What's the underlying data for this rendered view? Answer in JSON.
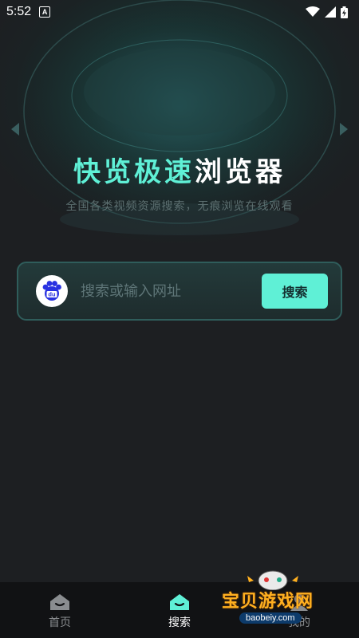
{
  "status_bar": {
    "time": "5:52",
    "notification_icon": "A"
  },
  "hero": {
    "title_part1": "快览极速",
    "title_part2": "浏览器",
    "subtitle": "全国各类视频资源搜索，无痕浏览在线观看"
  },
  "search": {
    "placeholder": "搜索或输入网址",
    "engine_icon": "baidu-logo-icon",
    "button_label": "搜索"
  },
  "nav": {
    "items": [
      {
        "label": "首页",
        "icon": "home-icon",
        "active": false
      },
      {
        "label": "搜索",
        "icon": "home-icon",
        "active": true
      },
      {
        "label": "我的",
        "icon": "user-icon",
        "active": false
      }
    ]
  },
  "watermark": {
    "text": "宝贝游戏网",
    "url": "baobeiy.com"
  },
  "colors": {
    "accent": "#5ff0d6",
    "background": "#1d1f22",
    "nav_background": "#111214"
  }
}
